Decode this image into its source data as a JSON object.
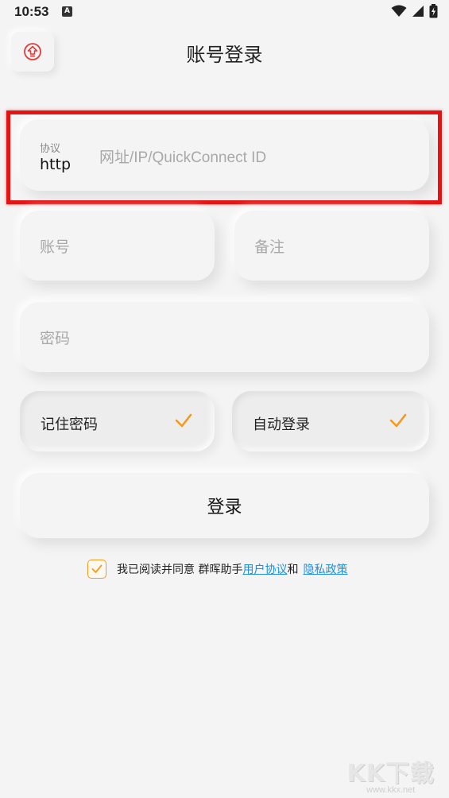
{
  "status_bar": {
    "time": "10:53",
    "notification_glyph": "A",
    "icons": [
      "wifi-icon",
      "signal-icon",
      "battery-charging-icon"
    ]
  },
  "header": {
    "title": "账号登录",
    "back_icon": "exit-arrow-icon"
  },
  "form": {
    "protocol_label": "协议",
    "protocol_value": "http",
    "address_placeholder": "网址/IP/QuickConnect ID",
    "account_placeholder": "账号",
    "remark_placeholder": "备注",
    "password_placeholder": "密码"
  },
  "options": {
    "remember_password": {
      "label": "记住密码",
      "checked": true
    },
    "auto_login": {
      "label": "自动登录",
      "checked": true
    }
  },
  "login_button": {
    "label": "登录"
  },
  "agreement": {
    "checked": true,
    "prefix": "我已阅读并同意 群晖助手",
    "user_agreement": "用户协议",
    "conjunction": "和",
    "privacy_policy": "隐私政策"
  },
  "watermark": {
    "logo": "KK下载",
    "url": "www.kkx.net"
  },
  "colors": {
    "accent": "#f29a20",
    "link": "#1d8fe0",
    "highlight": "#e41414",
    "background": "#f4f4f4"
  }
}
